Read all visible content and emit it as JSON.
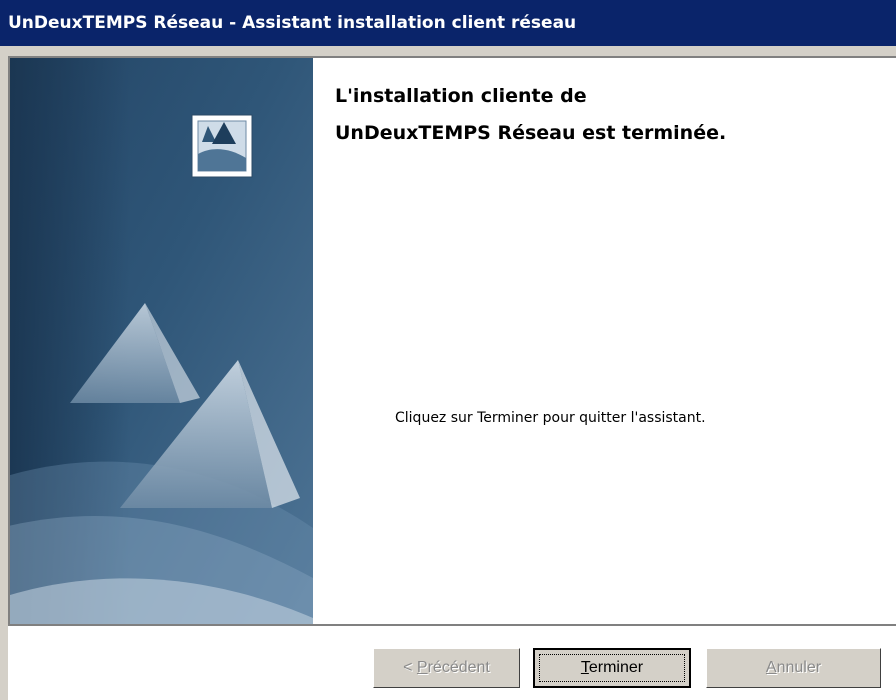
{
  "window": {
    "title": "UnDeuxTEMPS Réseau - Assistant installation client réseau"
  },
  "panel": {
    "logo_icon": "tent-logo-icon",
    "art": "tent-roofs-graphic"
  },
  "main": {
    "heading_line1": "L'installation cliente de",
    "heading_line2": "UnDeuxTEMPS Réseau est terminée.",
    "instruction": "Cliquez sur Terminer pour quitter l'assistant."
  },
  "buttons": {
    "previous": {
      "prefix": "< ",
      "mnemonic": "P",
      "rest": "récédent",
      "enabled": false
    },
    "finish": {
      "mnemonic": "T",
      "rest": "erminer",
      "enabled": true,
      "focused": true
    },
    "cancel": {
      "mnemonic": "A",
      "rest": "nnuler",
      "enabled": false
    }
  },
  "colors": {
    "titlebar": "#0a246a",
    "panel_dark": "#1e3e5c",
    "panel_light": "#6f93b1",
    "dialog_face": "#d4d0c8"
  }
}
